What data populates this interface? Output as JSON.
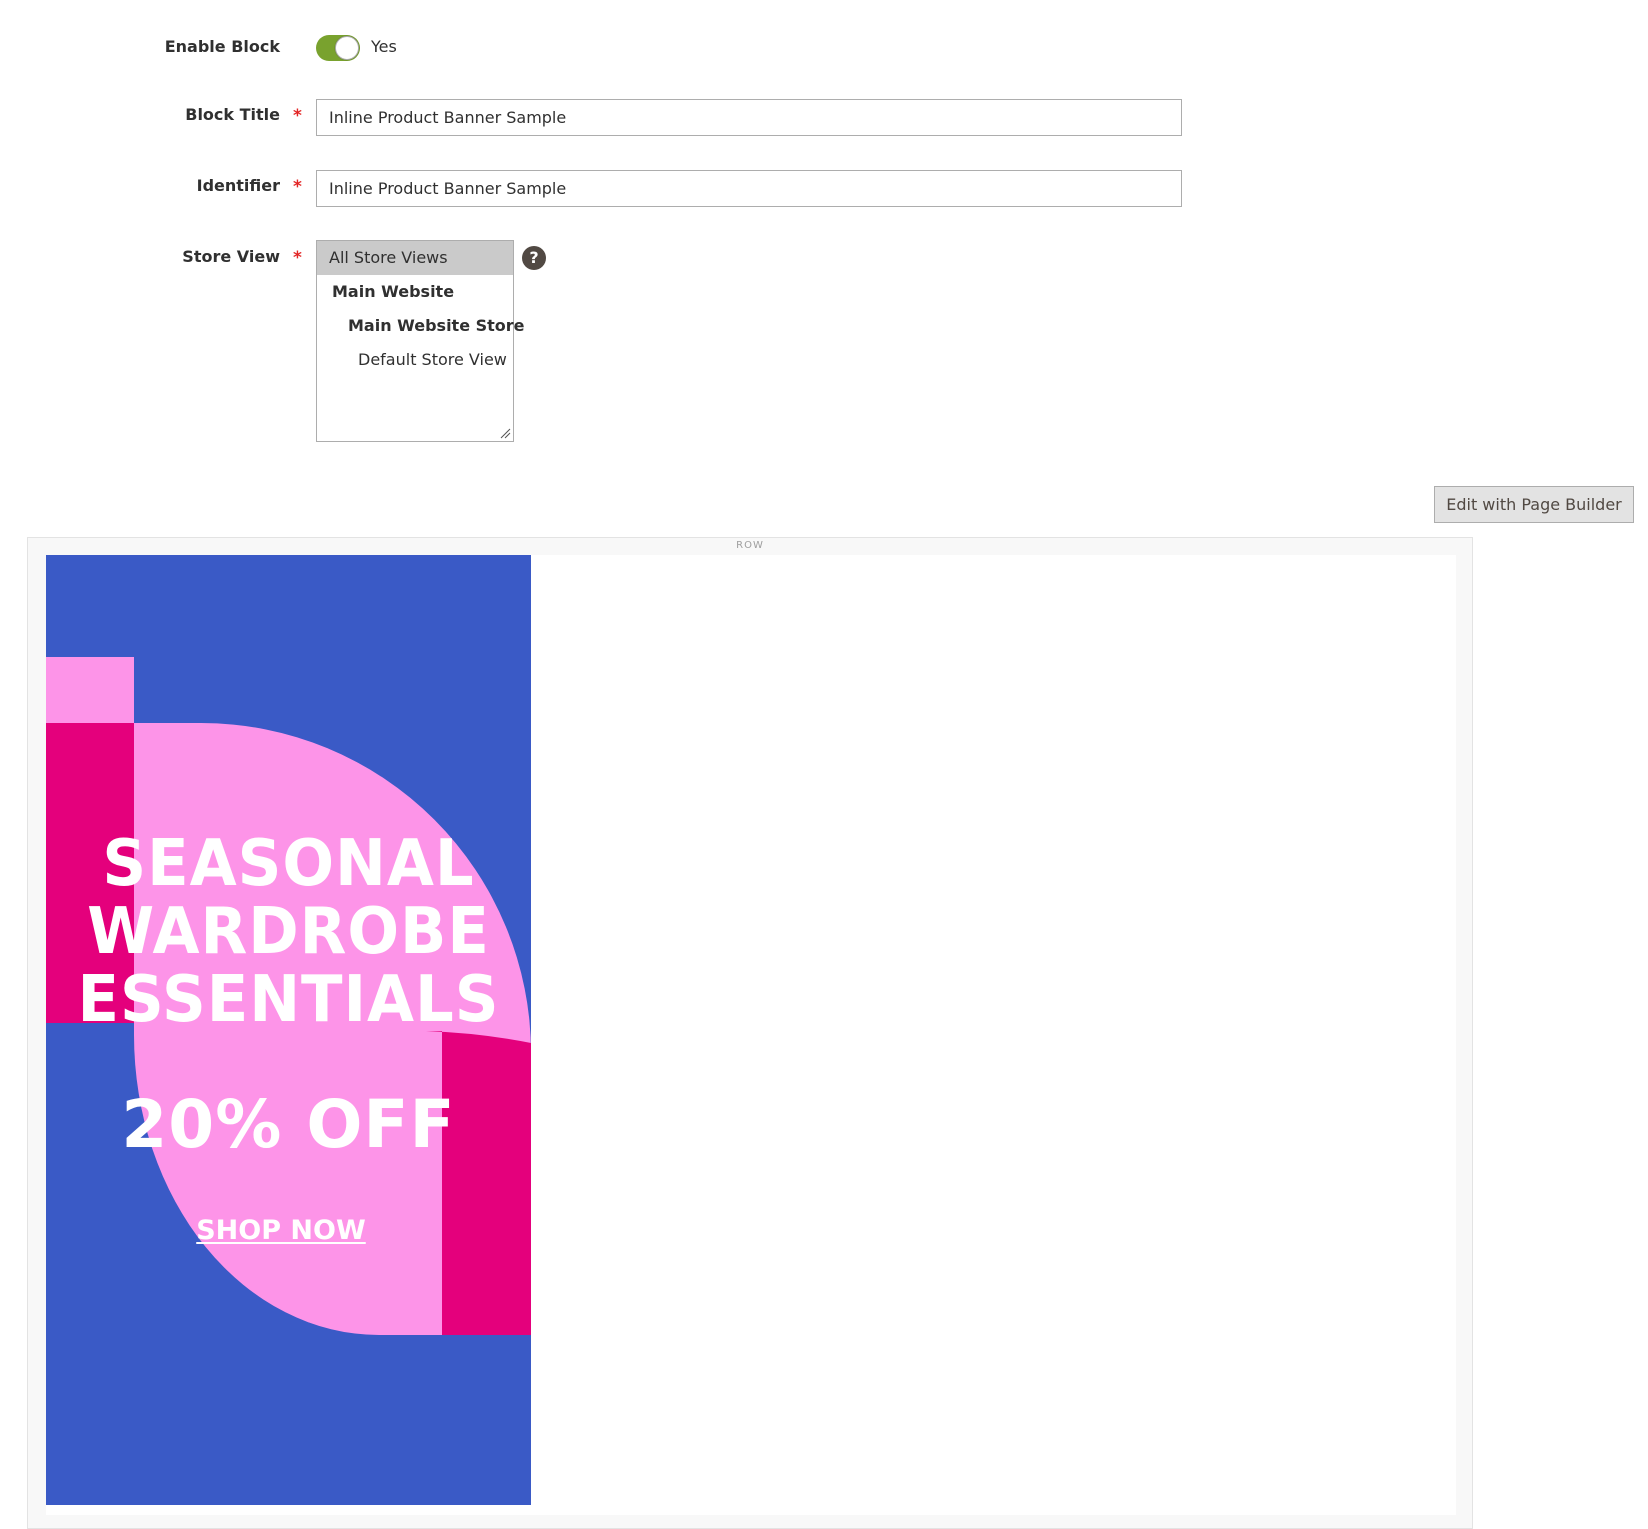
{
  "form": {
    "enable_block": {
      "label": "Enable Block",
      "value_label": "Yes",
      "enabled": true,
      "toggle_color": "#79a22e"
    },
    "block_title": {
      "label": "Block Title",
      "required_mark": "*",
      "value": "Inline Product Banner Sample"
    },
    "identifier": {
      "label": "Identifier",
      "required_mark": "*",
      "value": "Inline Product Banner Sample"
    },
    "store_view": {
      "label": "Store View",
      "required_mark": "*",
      "options": [
        {
          "label": "All Store Views",
          "selected": true
        },
        {
          "label": "Main Website"
        },
        {
          "label": "Main Website Store"
        },
        {
          "label": "Default Store View"
        }
      ],
      "help_glyph": "?"
    }
  },
  "page_builder": {
    "edit_button_label": "Edit with Page Builder",
    "row_label": "ROW",
    "banner": {
      "headline_lines": [
        "SEASONAL",
        "WARDROBE",
        "ESSENTIALS"
      ],
      "discount": "20% OFF",
      "cta": "SHOP NOW",
      "colors": {
        "background": "#3a5ac6",
        "accent_pink": "#fd94e8",
        "accent_magenta": "#e4007c"
      }
    }
  }
}
